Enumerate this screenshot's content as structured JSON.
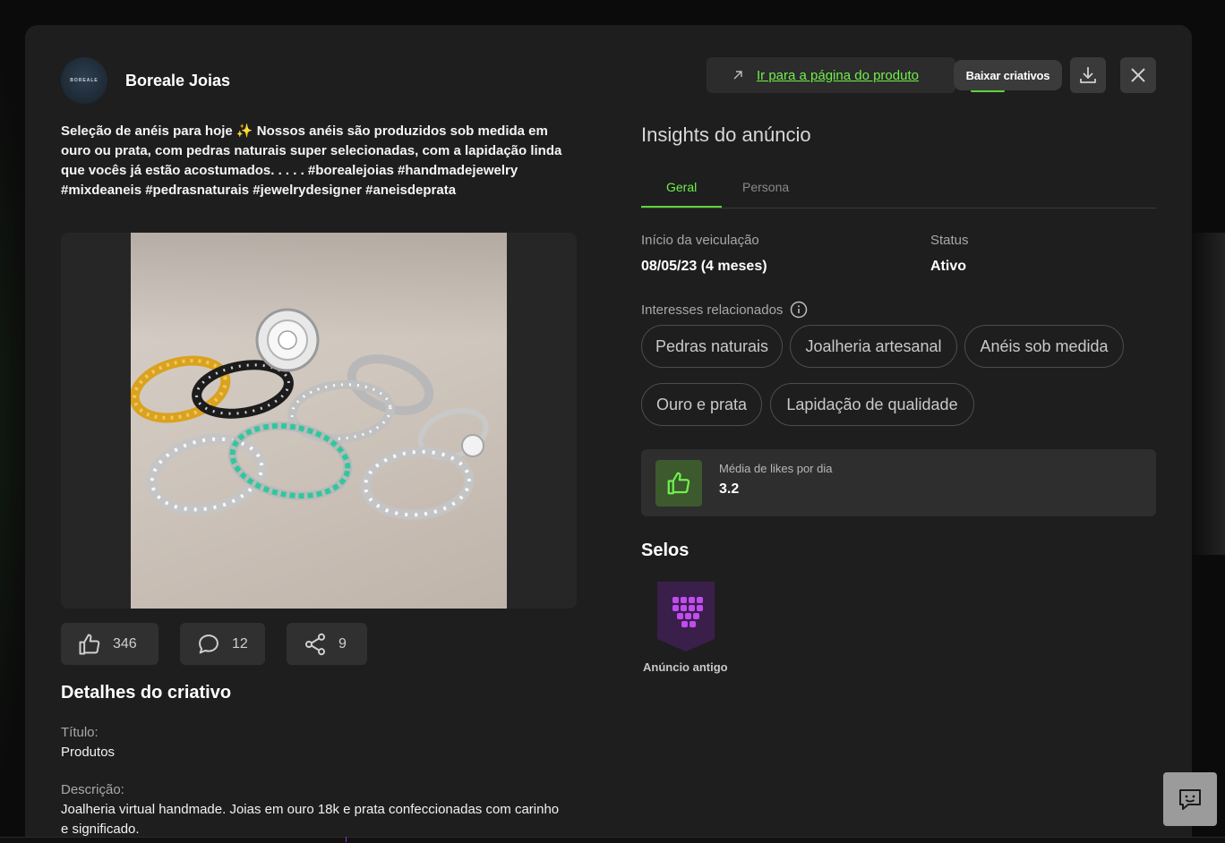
{
  "advertiser": {
    "avatar_text": "BOREALE",
    "name": "Boreale Joias"
  },
  "caption": "Seleção de anéis para hoje ✨ Nossos anéis são produzidos sob medida em ouro ou prata, com pedras naturais super selecionadas, com a lapidação linda que vocês já estão acostumados. . . . . #borealejoias #handmadejewelry #mixdeaneis #pedrasnaturais #jewelrydesigner #aneisdeprata",
  "engagement": {
    "likes": "346",
    "comments": "12",
    "shares": "9"
  },
  "details": {
    "title": "Detalhes do criativo",
    "title_label": "Título:",
    "title_value": "Produtos",
    "description_label": "Descrição:",
    "description_value": "Joalheria virtual handmade. Joias em ouro 18k e prata confeccionadas com carinho e significado."
  },
  "actions": {
    "goto_product": "Ir para a página do produto",
    "download_tooltip": "Baixar criativos"
  },
  "insights": {
    "title": "Insights do anúncio",
    "tabs": [
      {
        "label": "Geral",
        "active": true
      },
      {
        "label": "Persona",
        "active": false
      }
    ],
    "start_label": "Início da veiculação",
    "start_value": "08/05/23 (4 meses)",
    "status_label": "Status",
    "status_value": "Ativo",
    "interests_label": "Interesses relacionados",
    "interests": [
      "Pedras naturais",
      "Joalheria artesanal",
      "Anéis sob medida",
      "Ouro e prata",
      "Lapidação de qualidade"
    ],
    "likes_per_day_label": "Média de likes por dia",
    "likes_per_day_value": "3.2"
  },
  "seals": {
    "title": "Selos",
    "items": [
      {
        "label": "Anúncio antigo",
        "icon": "dots-grid-icon"
      }
    ]
  },
  "colors": {
    "accent": "#6ff04b",
    "background": "#1e1e1e",
    "badge": "#3a1f4a",
    "badge_icon": "#c24cf2"
  }
}
